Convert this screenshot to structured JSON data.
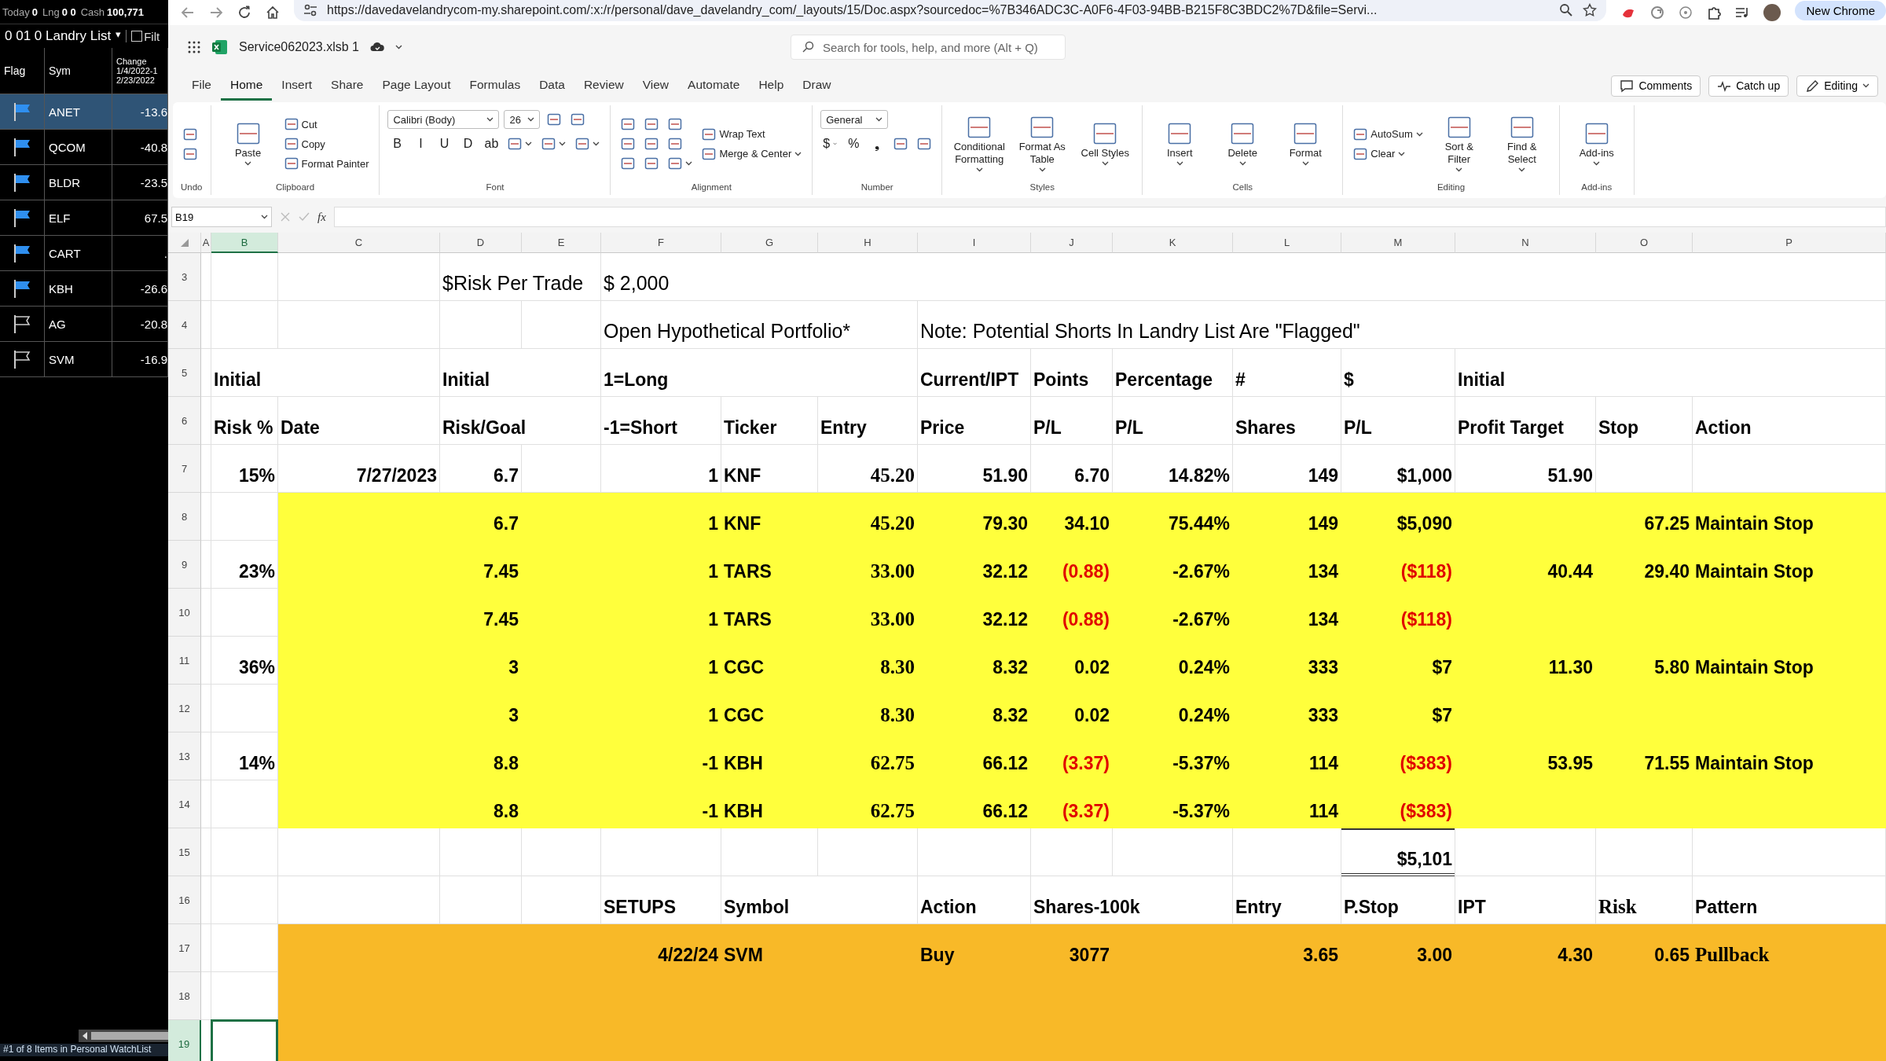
{
  "watchlist": {
    "summary": [
      {
        "label": "Today",
        "value": "0"
      },
      {
        "label": "Lng",
        "value": "0 0"
      },
      {
        "label": "Cash",
        "value": "100,771"
      }
    ],
    "list_name": "0 01 0 Landry List",
    "list_caret": "▾",
    "filter": {
      "label": "Filt",
      "checked": false
    },
    "columns": [
      {
        "lines": [
          "Flag"
        ]
      },
      {
        "lines": [
          "Sym"
        ]
      },
      {
        "lines": [
          "Change",
          "1/4/2022-1",
          "2/23/2022"
        ]
      }
    ],
    "rows": [
      {
        "flagged": true,
        "symbol": "ANET",
        "change": "-13.6",
        "selected": true
      },
      {
        "flagged": true,
        "symbol": "QCOM",
        "change": "-40.8",
        "selected": false
      },
      {
        "flagged": true,
        "symbol": "BLDR",
        "change": "-23.5",
        "selected": false
      },
      {
        "flagged": true,
        "symbol": "ELF",
        "change": "67.5",
        "selected": false
      },
      {
        "flagged": true,
        "symbol": "CART",
        "change": ".",
        "selected": false
      },
      {
        "flagged": true,
        "symbol": "KBH",
        "change": "-26.6",
        "selected": false
      },
      {
        "flagged": false,
        "symbol": "AG",
        "change": "-20.8",
        "selected": false
      },
      {
        "flagged": false,
        "symbol": "SVM",
        "change": "-16.9",
        "selected": false
      }
    ],
    "footer": "#1 of 8 Items in Personal WatchList"
  },
  "browser": {
    "url": "https://davedavelandrycom-my.sharepoint.com/:x:/r/personal/dave_davelandry_com/_layouts/15/Doc.aspx?sourcedoc=%7B346ADC3C-A0F6-4F03-94BB-B215F8C3BDC2%7D&file=Servi...",
    "new_chrome": "New Chrome"
  },
  "app": {
    "file_name": "Service062023.xlsb 1",
    "search": {
      "placeholder": "Search for tools, help, and more (Alt + Q)"
    },
    "menu": [
      {
        "label": "File",
        "selected": false
      },
      {
        "label": "Home",
        "selected": true
      },
      {
        "label": "Insert",
        "selected": false
      },
      {
        "label": "Share",
        "selected": false
      },
      {
        "label": "Page Layout",
        "selected": false
      },
      {
        "label": "Formulas",
        "selected": false
      },
      {
        "label": "Data",
        "selected": false
      },
      {
        "label": "Review",
        "selected": false
      },
      {
        "label": "View",
        "selected": false
      },
      {
        "label": "Automate",
        "selected": false
      },
      {
        "label": "Help",
        "selected": false
      },
      {
        "label": "Draw",
        "selected": false
      }
    ],
    "actions": [
      "Comments",
      "Catch up",
      "Editing"
    ],
    "ribbon": [
      {
        "label": "Undo",
        "kind": "stack",
        "items": [
          [
            {
              "kind": "icon"
            },
            {
              "kind": "icon"
            }
          ]
        ]
      },
      {
        "label": "Clipboard",
        "kind": "stack",
        "items": [
          [
            {
              "kind": "big",
              "text": "Paste",
              "caret": true
            }
          ],
          [
            {
              "kind": "small",
              "text": "Cut"
            },
            {
              "kind": "small",
              "text": "Copy"
            },
            {
              "kind": "small",
              "text": "Format Painter"
            }
          ]
        ]
      },
      {
        "label": "Font",
        "kind": "rows",
        "items": [
          [
            {
              "kind": "select",
              "text": "Calibri (Body)"
            },
            {
              "kind": "select",
              "text": "26"
            },
            {
              "kind": "icon"
            },
            {
              "kind": "icon"
            }
          ],
          [
            {
              "kind": "glyph",
              "text": "B"
            },
            {
              "kind": "glyph",
              "text": "I"
            },
            {
              "kind": "glyph",
              "text": "U"
            },
            {
              "kind": "glyph",
              "text": "D"
            },
            {
              "kind": "glyph",
              "text": "ab"
            },
            {
              "kind": "icon",
              "caret": true
            },
            {
              "kind": "icon",
              "caret": true
            },
            {
              "kind": "icon",
              "caret": true
            }
          ]
        ]
      },
      {
        "label": "Alignment",
        "kind": "stack",
        "items": [
          [
            {
              "kind": "icon"
            },
            {
              "kind": "icon"
            },
            {
              "kind": "icon"
            }
          ],
          [
            {
              "kind": "icon"
            },
            {
              "kind": "icon"
            },
            {
              "kind": "icon"
            }
          ],
          [
            {
              "kind": "icon"
            },
            {
              "kind": "icon"
            },
            {
              "kind": "icon",
              "caret": true
            }
          ],
          [
            {
              "kind": "small",
              "text": "Wrap Text"
            },
            {
              "kind": "small",
              "text": "Merge & Center",
              "caret": true
            }
          ]
        ]
      },
      {
        "label": "Number",
        "kind": "rows",
        "items": [
          [
            {
              "kind": "select",
              "text": "General"
            }
          ],
          [
            {
              "kind": "glyph",
              "text": "$",
              "caret": true
            },
            {
              "kind": "glyph",
              "text": "%"
            },
            {
              "kind": "glyph",
              "text": "❟"
            },
            {
              "kind": "icon"
            },
            {
              "kind": "icon"
            }
          ]
        ]
      },
      {
        "label": "Styles",
        "kind": "stack",
        "items": [
          [
            {
              "kind": "big",
              "text": "Conditional Formatting",
              "caret": true
            }
          ],
          [
            {
              "kind": "big",
              "text": "Format As Table",
              "caret": true
            }
          ],
          [
            {
              "kind": "big",
              "text": "Cell Styles",
              "caret": true
            }
          ]
        ]
      },
      {
        "label": "Cells",
        "kind": "stack",
        "items": [
          [
            {
              "kind": "big",
              "text": "Insert",
              "caret": true
            }
          ],
          [
            {
              "kind": "big",
              "text": "Delete",
              "caret": true
            }
          ],
          [
            {
              "kind": "big",
              "text": "Format",
              "caret": true
            }
          ]
        ]
      },
      {
        "label": "Editing",
        "kind": "stack",
        "items": [
          [
            {
              "kind": "small",
              "text": "AutoSum",
              "caret": true
            },
            {
              "kind": "small",
              "text": "Clear",
              "caret": true
            }
          ],
          [
            {
              "kind": "big",
              "text": "Sort & Filter",
              "caret": true
            }
          ],
          [
            {
              "kind": "big",
              "text": "Find & Select",
              "caret": true
            }
          ]
        ]
      },
      {
        "label": "Add-ins",
        "kind": "stack",
        "items": [
          [
            {
              "kind": "big",
              "text": "Add-ins",
              "caret": true
            }
          ]
        ]
      }
    ],
    "name_box": "B19",
    "fx": "fx"
  },
  "grid": {
    "columns": [
      {
        "label": "A",
        "selected": false
      },
      {
        "label": "B",
        "selected": true
      },
      {
        "label": "C",
        "selected": false
      },
      {
        "label": "D",
        "selected": false
      },
      {
        "label": "E",
        "selected": false
      },
      {
        "label": "F",
        "selected": false
      },
      {
        "label": "G",
        "selected": false
      },
      {
        "label": "H",
        "selected": false
      },
      {
        "label": "I",
        "selected": false
      },
      {
        "label": "J",
        "selected": false
      },
      {
        "label": "K",
        "selected": false
      },
      {
        "label": "L",
        "selected": false
      },
      {
        "label": "M",
        "selected": false
      },
      {
        "label": "N",
        "selected": false
      },
      {
        "label": "O",
        "selected": false
      },
      {
        "label": "P",
        "selected": false
      }
    ],
    "rows": [
      {
        "num": "3",
        "kind": "note",
        "selected": false,
        "cells": [
          {},
          {},
          {},
          {
            "kind": "label",
            "text": "$Risk Per Trade"
          },
          {},
          {
            "kind": "label",
            "text": "$      2,000"
          },
          {},
          {},
          {},
          {},
          {},
          {},
          {},
          {},
          {},
          {}
        ]
      },
      {
        "num": "4",
        "kind": "note",
        "selected": false,
        "cells": [
          {},
          {},
          {},
          {},
          {},
          {
            "kind": "label",
            "text": "Open Hypothetical Portfolio*"
          },
          {},
          {},
          {
            "kind": "label",
            "text": "Note: Potential Shorts In Landry List Are \"Flagged\""
          },
          {},
          {},
          {},
          {},
          {},
          {},
          {}
        ]
      },
      {
        "num": "5",
        "kind": "table",
        "selected": false,
        "cells": [
          {},
          {
            "kind": "label",
            "text": "Initial"
          },
          {},
          {
            "kind": "label",
            "text": "Initial"
          },
          {},
          {
            "kind": "label",
            "text": "1=Long"
          },
          {},
          {},
          {
            "kind": "label",
            "text": "Current/IPT"
          },
          {
            "kind": "label",
            "text": "Points"
          },
          {
            "kind": "label",
            "text": "Percentage"
          },
          {
            "kind": "label",
            "text": "#"
          },
          {
            "kind": "label",
            "text": "$"
          },
          {
            "kind": "label",
            "text": "Initial"
          },
          {},
          {}
        ]
      },
      {
        "num": "6",
        "kind": "table",
        "selected": false,
        "cells": [
          {},
          {
            "kind": "label",
            "text": "Risk %"
          },
          {
            "kind": "label",
            "text": "Date"
          },
          {
            "kind": "label",
            "text": "Risk/Goal"
          },
          {},
          {
            "kind": "label",
            "text": "-1=Short"
          },
          {
            "kind": "label",
            "text": "Ticker"
          },
          {
            "kind": "label",
            "text": "Entry"
          },
          {
            "kind": "label",
            "text": "Price"
          },
          {
            "kind": "label",
            "text": "P/L"
          },
          {
            "kind": "label",
            "text": "P/L"
          },
          {
            "kind": "label",
            "text": "Shares"
          },
          {
            "kind": "label",
            "text": "P/L"
          },
          {
            "kind": "label",
            "text": "Profit Target"
          },
          {
            "kind": "label",
            "text": "Stop"
          },
          {
            "kind": "label",
            "text": "Action"
          }
        ]
      },
      {
        "num": "7",
        "kind": "table",
        "selected": false,
        "cells": [
          {},
          {
            "kind": "number",
            "text": "15%"
          },
          {
            "kind": "number",
            "text": "7/27/2023"
          },
          {
            "kind": "number",
            "text": "6.7"
          },
          {},
          {
            "kind": "number",
            "text": "1"
          },
          {
            "kind": "label",
            "text": "KNF"
          },
          {
            "kind": "serif",
            "text": "45.20"
          },
          {
            "kind": "number",
            "text": "51.90"
          },
          {
            "kind": "number",
            "text": "6.70"
          },
          {
            "kind": "number",
            "text": "14.82%"
          },
          {
            "kind": "number",
            "text": "149"
          },
          {
            "kind": "number",
            "text": "$1,000"
          },
          {
            "kind": "number",
            "text": "51.90"
          },
          {},
          {}
        ]
      },
      {
        "num": "8",
        "kind": "table",
        "color": "#ffff3c",
        "selected": false,
        "cells": [
          {},
          {},
          {},
          {
            "kind": "number",
            "text": "6.7"
          },
          {},
          {
            "kind": "number",
            "text": "1"
          },
          {
            "kind": "label",
            "text": "KNF"
          },
          {
            "kind": "serif",
            "text": "45.20"
          },
          {
            "kind": "number",
            "text": "79.30"
          },
          {
            "kind": "number",
            "text": "34.10"
          },
          {
            "kind": "number",
            "text": "75.44%"
          },
          {
            "kind": "number",
            "text": "149"
          },
          {
            "kind": "number",
            "text": "$5,090"
          },
          {},
          {
            "kind": "number",
            "text": "67.25"
          },
          {
            "kind": "label",
            "text": "Maintain Stop"
          }
        ]
      },
      {
        "num": "9",
        "kind": "table",
        "color": "#ffff3c",
        "selected": false,
        "cells": [
          {},
          {
            "kind": "number",
            "text": "23%"
          },
          {},
          {
            "kind": "number",
            "text": "7.45"
          },
          {},
          {
            "kind": "number",
            "text": "1"
          },
          {
            "kind": "label",
            "text": "TARS"
          },
          {
            "kind": "serif",
            "text": "33.00"
          },
          {
            "kind": "number",
            "text": "32.12"
          },
          {
            "kind": "loss",
            "text": "(0.88)"
          },
          {
            "kind": "number",
            "text": "-2.67%"
          },
          {
            "kind": "number",
            "text": "134"
          },
          {
            "kind": "loss",
            "text": "($118)"
          },
          {
            "kind": "number",
            "text": "40.44"
          },
          {
            "kind": "number",
            "text": "29.40"
          },
          {
            "kind": "label",
            "text": "Maintain Stop"
          }
        ]
      },
      {
        "num": "10",
        "kind": "table",
        "color": "#ffff3c",
        "selected": false,
        "cells": [
          {},
          {},
          {},
          {
            "kind": "number",
            "text": "7.45"
          },
          {},
          {
            "kind": "number",
            "text": "1"
          },
          {
            "kind": "label",
            "text": "TARS"
          },
          {
            "kind": "serif",
            "text": "33.00"
          },
          {
            "kind": "number",
            "text": "32.12"
          },
          {
            "kind": "loss",
            "text": "(0.88)"
          },
          {
            "kind": "number",
            "text": "-2.67%"
          },
          {
            "kind": "number",
            "text": "134"
          },
          {
            "kind": "loss",
            "text": "($118)"
          },
          {},
          {},
          {}
        ]
      },
      {
        "num": "11",
        "kind": "table",
        "color": "#ffff3c",
        "selected": false,
        "cells": [
          {},
          {
            "kind": "number",
            "text": "36%"
          },
          {},
          {
            "kind": "number",
            "text": "3"
          },
          {},
          {
            "kind": "number",
            "text": "1"
          },
          {
            "kind": "label",
            "text": "CGC"
          },
          {
            "kind": "serif",
            "text": "8.30"
          },
          {
            "kind": "number",
            "text": "8.32"
          },
          {
            "kind": "number",
            "text": "0.02"
          },
          {
            "kind": "number",
            "text": "0.24%"
          },
          {
            "kind": "number",
            "text": "333"
          },
          {
            "kind": "number",
            "text": "$7"
          },
          {
            "kind": "number",
            "text": "11.30"
          },
          {
            "kind": "number",
            "text": "5.80"
          },
          {
            "kind": "label",
            "text": "Maintain Stop"
          }
        ]
      },
      {
        "num": "12",
        "kind": "table",
        "color": "#ffff3c",
        "selected": false,
        "cells": [
          {},
          {},
          {},
          {
            "kind": "number",
            "text": "3"
          },
          {},
          {
            "kind": "number",
            "text": "1"
          },
          {
            "kind": "label",
            "text": "CGC"
          },
          {
            "kind": "serif",
            "text": "8.30"
          },
          {
            "kind": "number",
            "text": "8.32"
          },
          {
            "kind": "number",
            "text": "0.02"
          },
          {
            "kind": "number",
            "text": "0.24%"
          },
          {
            "kind": "number",
            "text": "333"
          },
          {
            "kind": "number",
            "text": "$7"
          },
          {},
          {},
          {}
        ]
      },
      {
        "num": "13",
        "kind": "table",
        "color": "#ffff3c",
        "selected": false,
        "cells": [
          {},
          {
            "kind": "number",
            "text": "14%"
          },
          {},
          {
            "kind": "number",
            "text": "8.8"
          },
          {},
          {
            "kind": "number",
            "text": "-1"
          },
          {
            "kind": "label",
            "text": "KBH"
          },
          {
            "kind": "serif",
            "text": "62.75"
          },
          {
            "kind": "number",
            "text": "66.12"
          },
          {
            "kind": "loss",
            "text": "(3.37)"
          },
          {
            "kind": "number",
            "text": "-5.37%"
          },
          {
            "kind": "number",
            "text": "114"
          },
          {
            "kind": "loss",
            "text": "($383)"
          },
          {
            "kind": "number",
            "text": "53.95"
          },
          {
            "kind": "number",
            "text": "71.55"
          },
          {
            "kind": "label",
            "text": "Maintain Stop"
          }
        ]
      },
      {
        "num": "14",
        "kind": "table",
        "color": "#ffff3c",
        "selected": false,
        "cells": [
          {},
          {},
          {},
          {
            "kind": "number",
            "text": "8.8"
          },
          {},
          {
            "kind": "number",
            "text": "-1"
          },
          {
            "kind": "label",
            "text": "KBH"
          },
          {
            "kind": "serif",
            "text": "62.75"
          },
          {
            "kind": "number",
            "text": "66.12"
          },
          {
            "kind": "loss",
            "text": "(3.37)"
          },
          {
            "kind": "number",
            "text": "-5.37%"
          },
          {
            "kind": "number",
            "text": "114"
          },
          {
            "kind": "loss",
            "text": "($383)"
          },
          {},
          {},
          {}
        ]
      },
      {
        "num": "15",
        "kind": "table",
        "selected": false,
        "cells": [
          {},
          {},
          {},
          {},
          {},
          {},
          {},
          {},
          {},
          {},
          {},
          {},
          {
            "kind": "total",
            "text": "$5,101"
          },
          {},
          {},
          {}
        ]
      },
      {
        "num": "16",
        "kind": "table",
        "selected": false,
        "cells": [
          {},
          {},
          {},
          {},
          {},
          {
            "kind": "label",
            "text": "SETUPS"
          },
          {
            "kind": "label",
            "text": "Symbol"
          },
          {},
          {
            "kind": "label",
            "text": "Action"
          },
          {
            "kind": "label",
            "text": "Shares-100k"
          },
          {},
          {
            "kind": "label",
            "text": "Entry"
          },
          {
            "kind": "label",
            "text": "P.Stop"
          },
          {
            "kind": "label",
            "text": "IPT"
          },
          {
            "kind": "serif-label",
            "text": "Risk"
          },
          {
            "kind": "label",
            "text": "Pattern"
          }
        ]
      },
      {
        "num": "17",
        "kind": "table",
        "color": "#f8b928",
        "selected": false,
        "cells": [
          {},
          {},
          {},
          {},
          {},
          {
            "kind": "number",
            "text": "4/22/24"
          },
          {
            "kind": "label",
            "text": "SVM"
          },
          {},
          {
            "kind": "label",
            "text": "Buy"
          },
          {
            "kind": "number",
            "text": "3077"
          },
          {},
          {
            "kind": "number",
            "text": "3.65"
          },
          {
            "kind": "number",
            "text": "3.00"
          },
          {
            "kind": "number",
            "text": "4.30"
          },
          {
            "kind": "number",
            "text": "0.65"
          },
          {
            "kind": "serif-label",
            "text": "Pullback"
          }
        ]
      },
      {
        "num": "18",
        "color": "#f8b928",
        "selected": false,
        "cells": [
          {},
          {},
          {},
          {},
          {},
          {},
          {},
          {},
          {},
          {},
          {},
          {},
          {},
          {},
          {},
          {}
        ]
      },
      {
        "num": "19",
        "color": "#f8b928",
        "selected": true,
        "cells": [
          {},
          {},
          {},
          {},
          {},
          {},
          {},
          {},
          {},
          {},
          {},
          {},
          {},
          {},
          {},
          {}
        ]
      }
    ]
  }
}
